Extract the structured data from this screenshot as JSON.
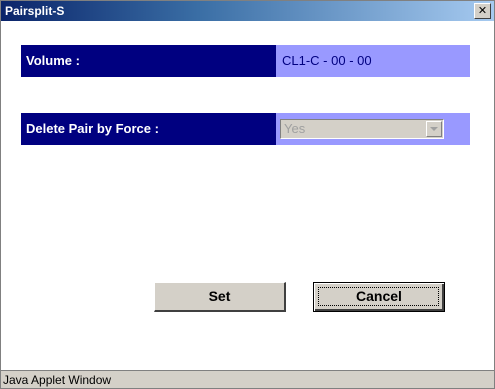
{
  "window": {
    "title": "Pairsplit-S",
    "close_glyph": "✕"
  },
  "form": {
    "volume_label": "Volume :",
    "volume_value": "CL1-C - 00 - 00",
    "delete_label": "Delete Pair by Force :",
    "delete_selected": "Yes"
  },
  "buttons": {
    "set_label": "Set",
    "cancel_label": "Cancel"
  },
  "status": {
    "text": "Java Applet Window"
  },
  "colors": {
    "label_bg": "#000080",
    "value_bg": "#9999ff",
    "button_bg": "#d4d0c8"
  }
}
